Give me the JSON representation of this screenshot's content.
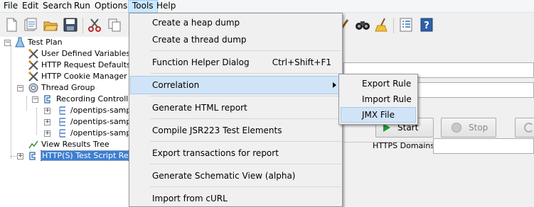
{
  "menubar": {
    "items": [
      "File",
      "Edit",
      "Search",
      "Run",
      "Options",
      "Tools",
      "Help"
    ],
    "active": "Tools"
  },
  "toolbar": {
    "icons": [
      "new-icon",
      "templates-icon",
      "open-icon",
      "save-icon",
      "cut-icon",
      "copy-icon",
      "clear-all-icon",
      "search-icon",
      "clear-icon",
      "function-list-icon",
      "help-icon"
    ]
  },
  "tree": {
    "nodes": [
      {
        "label": "Test Plan",
        "icon": "test-plan-icon"
      },
      {
        "label": "User Defined Variables",
        "icon": "config-element-icon"
      },
      {
        "label": "HTTP Request Defaults",
        "icon": "config-element-icon"
      },
      {
        "label": "HTTP Cookie Manager",
        "icon": "config-element-icon"
      },
      {
        "label": "Thread Group",
        "icon": "thread-group-icon"
      },
      {
        "label": "Recording Controller",
        "icon": "controller-icon"
      },
      {
        "label": "/opentips-sample",
        "icon": "sampler-icon"
      },
      {
        "label": "/opentips-sample",
        "icon": "sampler-icon"
      },
      {
        "label": "/opentips-sample",
        "icon": "sampler-icon"
      },
      {
        "label": "View Results Tree",
        "icon": "listener-icon"
      },
      {
        "label": "HTTP(S) Test Script Rec",
        "icon": "recorder-icon"
      }
    ]
  },
  "content": {
    "start_label": "Start",
    "stop_label": "Stop",
    "https_domains_label": "HTTPS Domains:",
    "https_domains_value": ""
  },
  "tools_menu": {
    "items": [
      {
        "label": "Create a heap dump",
        "shortcut": ""
      },
      {
        "label": "Create a thread dump",
        "shortcut": ""
      },
      {
        "label": "Function Helper Dialog",
        "shortcut": "Ctrl+Shift+F1"
      },
      {
        "label": "Correlation",
        "shortcut": ""
      },
      {
        "label": "Generate HTML report",
        "shortcut": ""
      },
      {
        "label": "Compile JSR223 Test Elements",
        "shortcut": ""
      },
      {
        "label": "Export transactions for report",
        "shortcut": ""
      },
      {
        "label": "Generate Schematic View (alpha)",
        "shortcut": ""
      },
      {
        "label": "Import from cURL",
        "shortcut": ""
      }
    ],
    "highlighted": "Correlation"
  },
  "correlation_submenu": {
    "items": [
      "Export Rule",
      "Import Rule",
      "JMX File"
    ],
    "highlighted": "JMX File"
  },
  "colors": {
    "menu_highlight": "#d1e4f7",
    "tree_selection": "#3d7fd1",
    "start_green": "#1a9b2e"
  }
}
